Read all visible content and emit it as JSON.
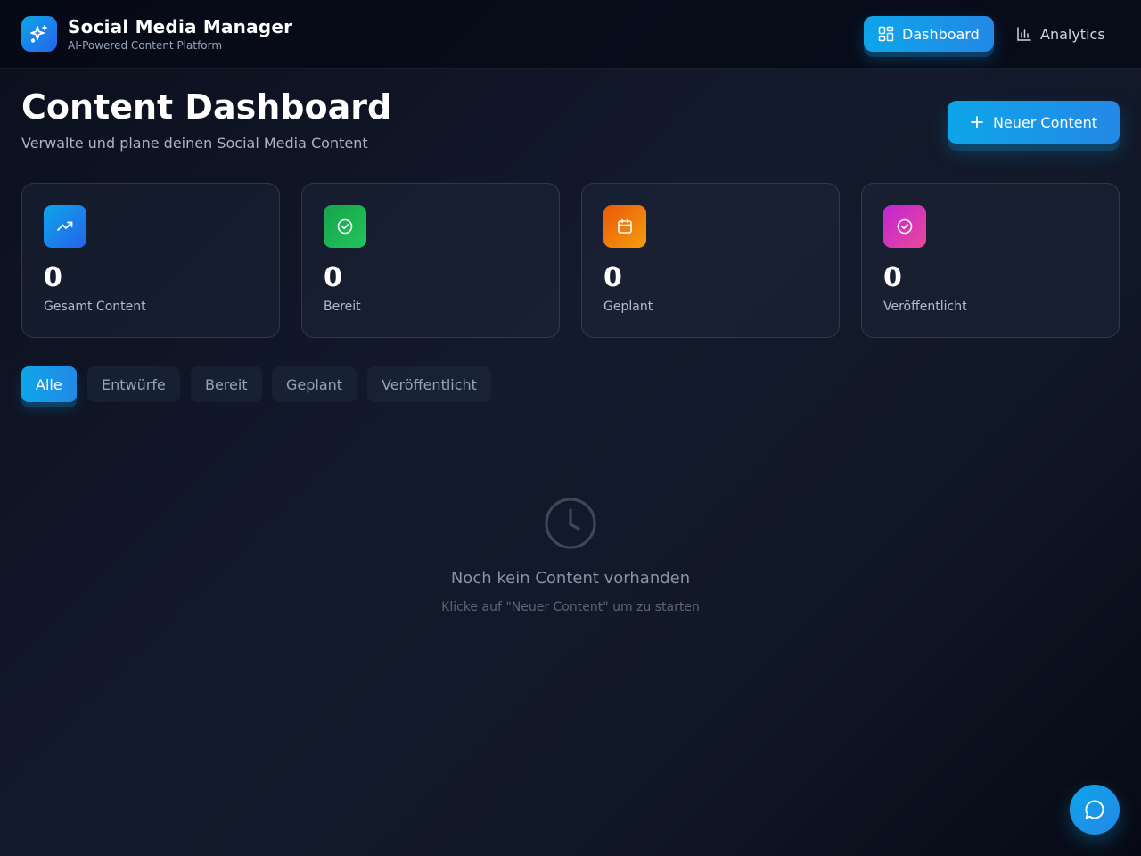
{
  "header": {
    "title": "Social Media Manager",
    "subtitle": "AI-Powered Content Platform",
    "logo_icon": "sparkles-icon",
    "nav": [
      {
        "label": "Dashboard",
        "icon": "grid-icon",
        "active": true
      },
      {
        "label": "Analytics",
        "icon": "bar-chart-icon",
        "active": false
      }
    ]
  },
  "main": {
    "title": "Content Dashboard",
    "subtitle": "Verwalte und plane deinen Social Media Content",
    "new_button": {
      "label": "Neuer Content",
      "icon": "plus-icon"
    }
  },
  "stats": [
    {
      "value": "0",
      "label": "Gesamt Content",
      "icon": "trending-up-icon",
      "color_from": "#0ea5e9",
      "color_to": "#2563eb"
    },
    {
      "value": "0",
      "label": "Bereit",
      "icon": "check-circle-icon",
      "color_from": "#16a34a",
      "color_to": "#22c55e"
    },
    {
      "value": "0",
      "label": "Geplant",
      "icon": "calendar-icon",
      "color_from": "#ea580c",
      "color_to": "#f59e0b"
    },
    {
      "value": "0",
      "label": "Veröffentlicht",
      "icon": "check-circle-icon",
      "color_from": "#c026d3",
      "color_to": "#ec4899"
    }
  ],
  "filters": [
    {
      "label": "Alle",
      "active": true
    },
    {
      "label": "Entwürfe",
      "active": false
    },
    {
      "label": "Bereit",
      "active": false
    },
    {
      "label": "Geplant",
      "active": false
    },
    {
      "label": "Veröffentlicht",
      "active": false
    }
  ],
  "empty_state": {
    "icon": "clock-icon",
    "title": "Noch kein Content vorhanden",
    "subtitle": "Klicke auf \"Neuer Content\" um zu starten"
  },
  "chat_button": {
    "icon": "chat-bubble-icon"
  }
}
